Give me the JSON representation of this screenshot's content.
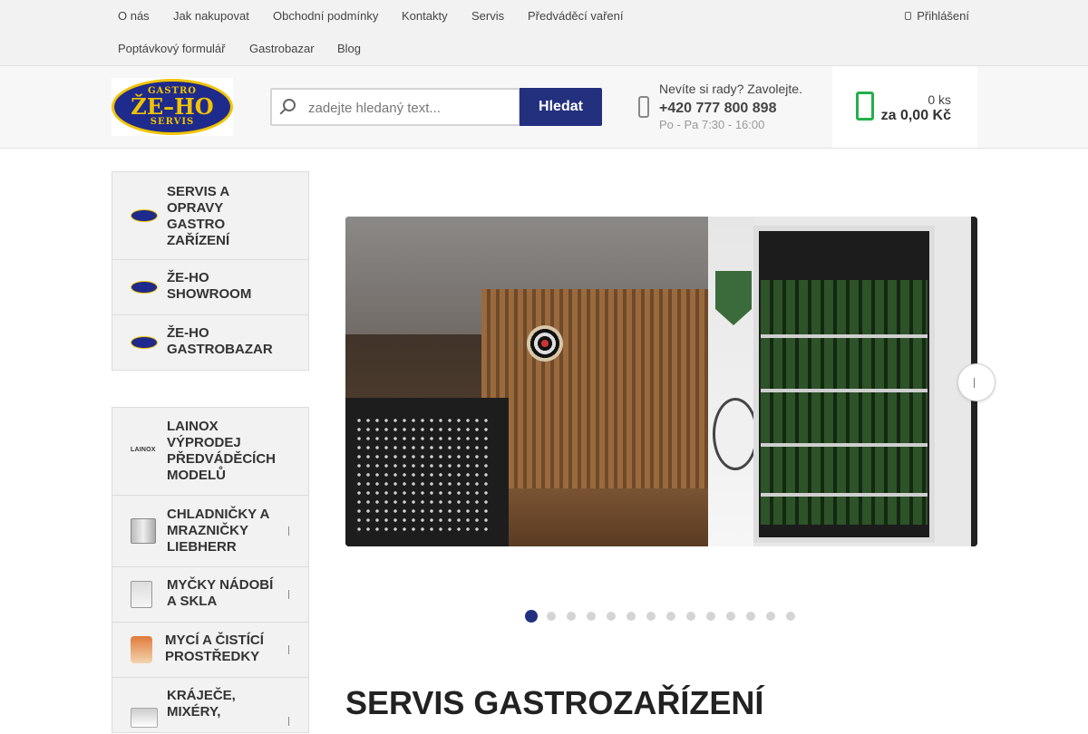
{
  "topnav": {
    "items": [
      "O nás",
      "Jak nakupovat",
      "Obchodní podmínky",
      "Kontakty",
      "Servis",
      "Předváděcí vaření",
      "Poptávkový formulář",
      "Gastrobazar",
      "Blog"
    ],
    "login_label": "Přihlášení",
    "login_icon": "lock-icon"
  },
  "logo": {
    "top": "GASTRO",
    "middle": "ŽE–HO",
    "bottom": "SERVIS"
  },
  "search": {
    "placeholder": "zadejte hledaný text...",
    "value": "",
    "button_label": "Hledat"
  },
  "help": {
    "title": "Nevíte si rady? Zavolejte.",
    "phone": "+420 777 800 898",
    "hours": "Po - Pa 7:30 - 16:00"
  },
  "cart": {
    "count": "0 ks",
    "total": "za 0,00 Kč"
  },
  "sidebar_top": {
    "items": [
      {
        "label": "SERVIS A OPRAVY GASTRO ZAŘÍZENÍ",
        "icon": "zeho-logo-icon"
      },
      {
        "label": "ŽE-HO SHOWROOM",
        "icon": "zeho-logo-icon"
      },
      {
        "label": "ŽE-HO GASTROBAZAR",
        "icon": "zeho-logo-icon"
      }
    ]
  },
  "sidebar_categories": {
    "items": [
      {
        "label": "LAINOX VÝPRODEJ PŘEDVÁDĚCÍCH MODELŮ",
        "icon": "lainox-logo-icon",
        "icon_text": "LAINOX",
        "has_submenu": false
      },
      {
        "label": "CHLADNIČKY A MRAZNIČKY LIEBHERR",
        "icon": "fridge-icon",
        "has_submenu": true
      },
      {
        "label": "MYČKY NÁDOBÍ A SKLA",
        "icon": "dishwasher-icon",
        "has_submenu": true
      },
      {
        "label": "MYCÍ A ČISTÍCÍ PROSTŘEDKY",
        "icon": "cleaning-products-icon",
        "has_submenu": true
      },
      {
        "label": "KRÁJEČE, MIXÉRY,",
        "icon": "slicer-icon",
        "has_submenu": true
      }
    ]
  },
  "slider": {
    "slide_count": 14,
    "active_index": 0
  },
  "main": {
    "title": "SERVIS GASTROZAŘÍZENÍ"
  },
  "colors": {
    "brand_blue": "#23307e",
    "brand_yellow": "#f1c400",
    "cart_green": "#23b04a"
  }
}
